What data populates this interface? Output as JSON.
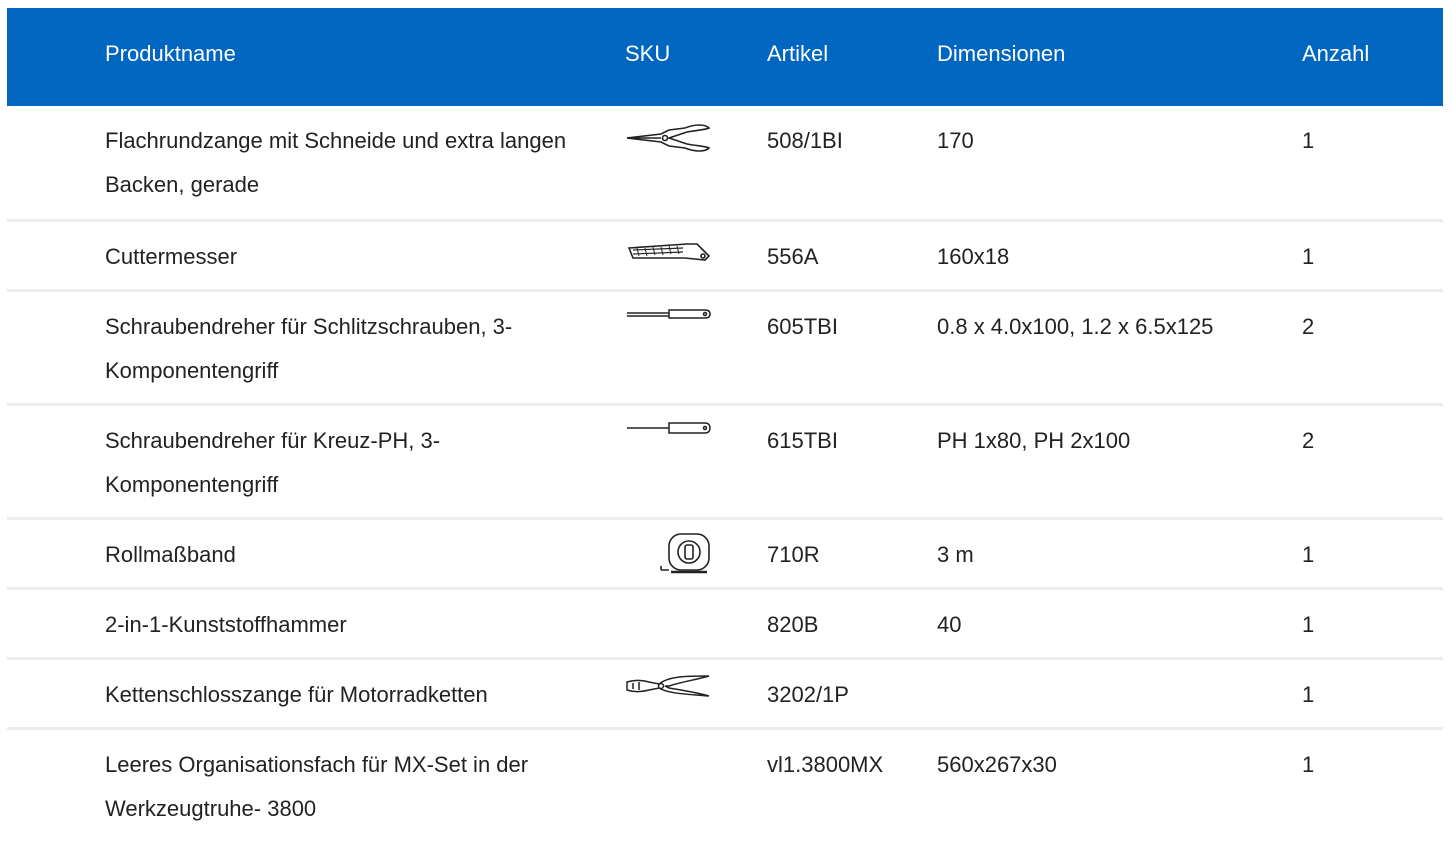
{
  "table": {
    "headers": {
      "name": "Produktname",
      "sku": "SKU",
      "article": "Artikel",
      "dimensions": "Dimensionen",
      "quantity": "Anzahl"
    },
    "rows": [
      {
        "name": "Flachrundzange mit Schneide und extra langen Backen, gerade",
        "sku_icon": "pliers-icon",
        "article": "508/1BI",
        "dimensions": "170",
        "quantity": "1"
      },
      {
        "name": "Cuttermesser",
        "sku_icon": "cutter-knife-icon",
        "article": "556A",
        "dimensions": "160x18",
        "quantity": "1"
      },
      {
        "name": "Schraubendreher für Schlitzschrauben, 3-Komponentengriff",
        "sku_icon": "screwdriver-icon",
        "article": "605TBI",
        "dimensions": "0.8 x 4.0x100, 1.2 x 6.5x125",
        "quantity": "2"
      },
      {
        "name": "Schraubendreher für Kreuz-PH, 3-Komponentengriff",
        "sku_icon": "screwdriver-icon",
        "article": "615TBI",
        "dimensions": "PH 1x80, PH 2x100",
        "quantity": "2"
      },
      {
        "name": "Rollmaßband",
        "sku_icon": "tape-measure-icon",
        "article": "710R",
        "dimensions": "3 m",
        "quantity": "1"
      },
      {
        "name": "2-in-1-Kunststoffhammer",
        "sku_icon": "",
        "article": "820B",
        "dimensions": "40",
        "quantity": "1"
      },
      {
        "name": "Kettenschlosszange für Motorradketten",
        "sku_icon": "chain-pliers-icon",
        "article": "3202/1P",
        "dimensions": "",
        "quantity": "1"
      },
      {
        "name": "Leeres Organisationsfach für MX-Set in der Werkzeugtruhe- 3800",
        "sku_icon": "",
        "article": "vl1.3800MX",
        "dimensions": "560x267x30",
        "quantity": "1"
      }
    ]
  },
  "colors": {
    "header_bg": "#0066bf",
    "header_text": "#ffffff",
    "row_divider": "#ececec",
    "body_text": "#222222"
  }
}
